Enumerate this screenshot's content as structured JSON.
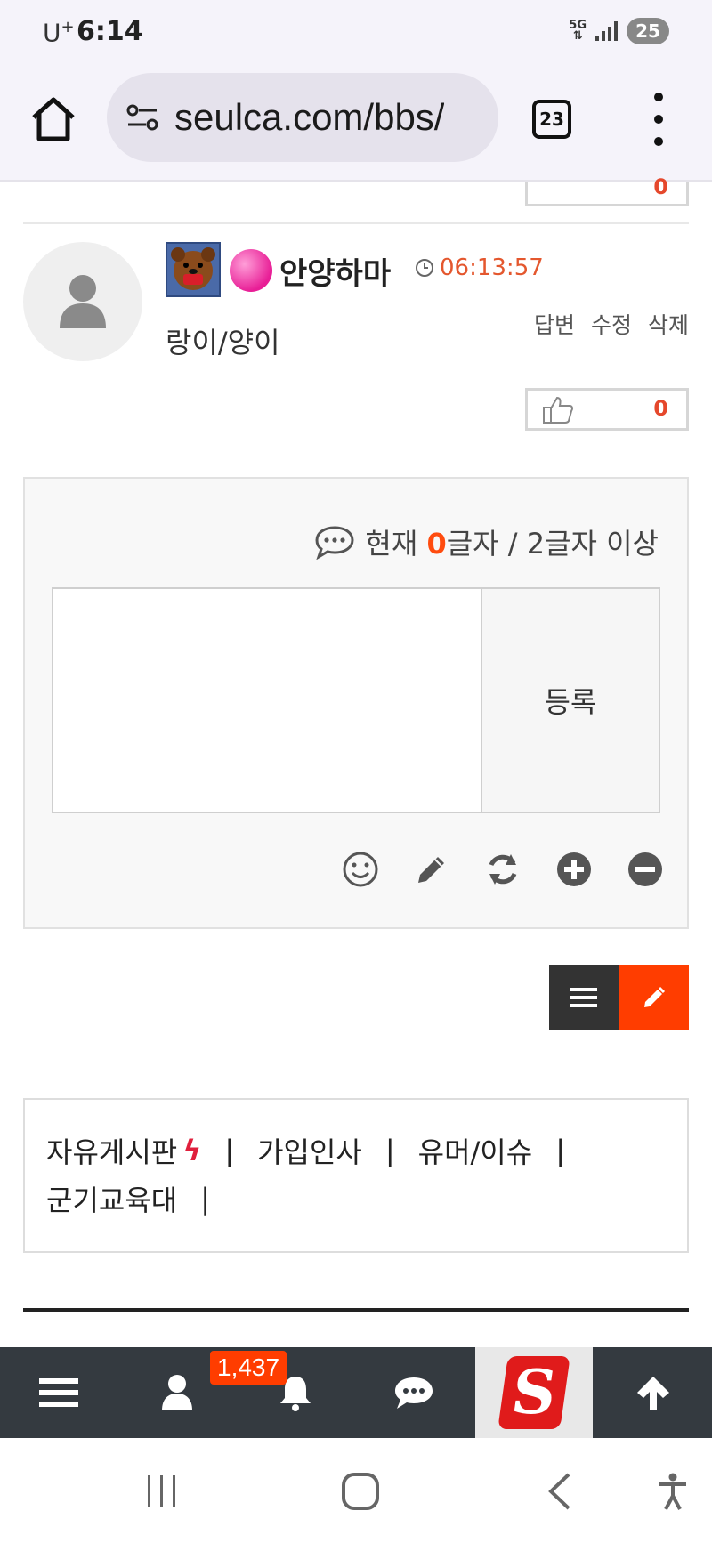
{
  "status_bar": {
    "carrier": "U",
    "carrier_sup": "+",
    "time": "6:14",
    "network": "5G",
    "battery": "25"
  },
  "browser": {
    "url": "seulca.com/bbs/",
    "tab_count": "23"
  },
  "previous_comment": {
    "like_count": "0"
  },
  "comment": {
    "nickname": "안양하마",
    "time": "06:13:57",
    "actions": [
      "답변",
      "수정",
      "삭제"
    ],
    "text": "랑이/양이",
    "like_count": "0"
  },
  "comment_form": {
    "count_prefix": "현재 ",
    "count_value": "0",
    "count_suffix": "글자 / 2글자 이상",
    "submit_label": "등록",
    "tools": [
      "smile-icon",
      "pencil-icon",
      "refresh-icon",
      "plus-circle-icon",
      "minus-circle-icon"
    ]
  },
  "board_nav": {
    "items": [
      "자유게시판",
      "가입인사",
      "유머/이슈",
      "군기교육대"
    ],
    "separator": "|"
  },
  "bottom_nav": {
    "notification_count": "1,437",
    "logo_letter": "S"
  },
  "colors": {
    "accent": "#ff3d00",
    "time_color": "#e4572e",
    "nav_bg": "#343a40"
  }
}
